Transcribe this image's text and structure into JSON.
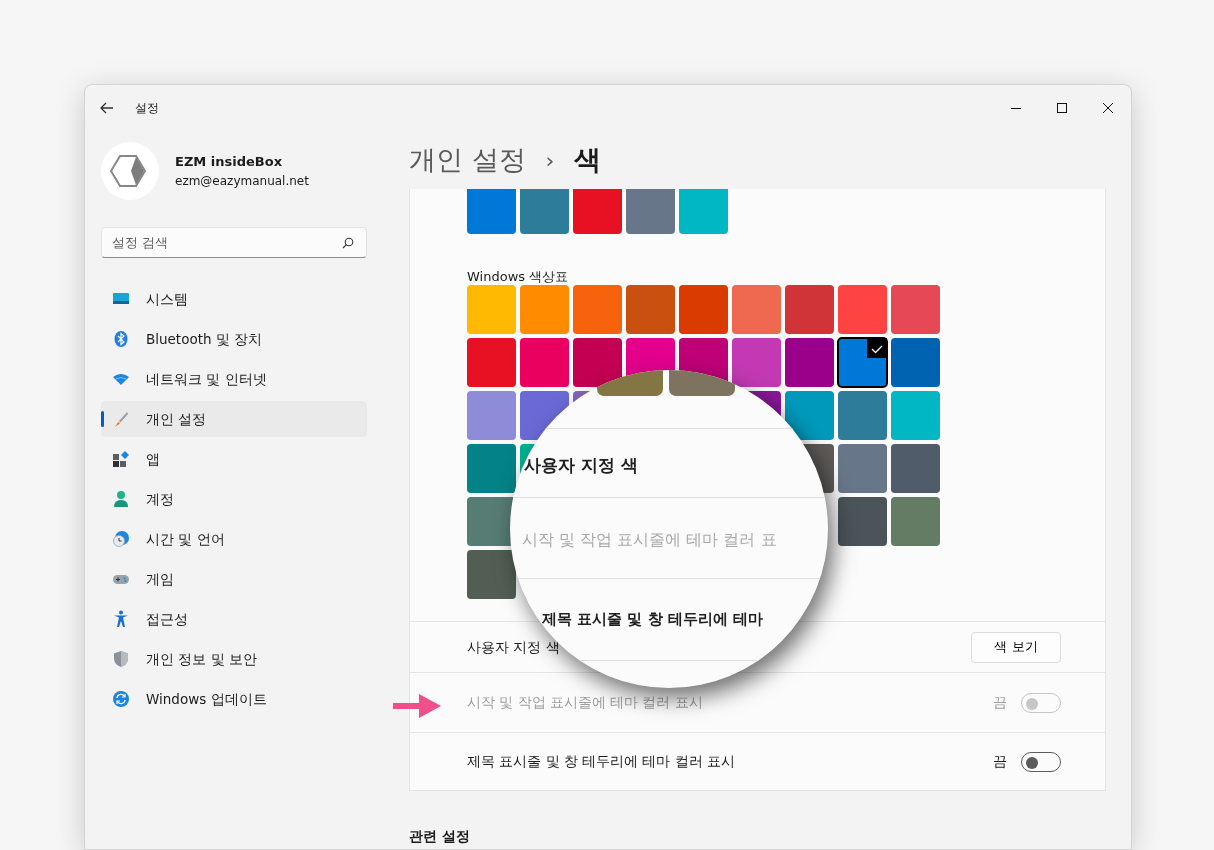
{
  "window": {
    "title": "설정"
  },
  "account": {
    "name": "EZM insideBox",
    "email": "ezm@eazymanual.net"
  },
  "search": {
    "placeholder": "설정 검색"
  },
  "sidebar": {
    "items": [
      {
        "label": "시스템",
        "kind": "system",
        "selected": false
      },
      {
        "label": "Bluetooth 및 장치",
        "kind": "bluetooth",
        "selected": false
      },
      {
        "label": "네트워크 및 인터넷",
        "kind": "network",
        "selected": false
      },
      {
        "label": "개인 설정",
        "kind": "personalization",
        "selected": true
      },
      {
        "label": "앱",
        "kind": "apps",
        "selected": false
      },
      {
        "label": "계정",
        "kind": "accounts",
        "selected": false
      },
      {
        "label": "시간 및 언어",
        "kind": "time",
        "selected": false
      },
      {
        "label": "게임",
        "kind": "gaming",
        "selected": false
      },
      {
        "label": "접근성",
        "kind": "accessibility",
        "selected": false
      },
      {
        "label": "개인 정보 및 보안",
        "kind": "privacy",
        "selected": false
      },
      {
        "label": "Windows 업데이트",
        "kind": "update",
        "selected": false
      }
    ]
  },
  "breadcrumb": {
    "parent": "개인 설정",
    "separator": "›",
    "current": "색"
  },
  "recent_colors": [
    {
      "color": "#0078d7"
    },
    {
      "color": "#2d7d9a"
    },
    {
      "color": "#e81123"
    },
    {
      "color": "#68768a"
    },
    {
      "color": "#00b7c3"
    }
  ],
  "palette": {
    "title": "Windows 색상표",
    "rows": [
      {
        "left": [
          {
            "color": "#ffb900",
            "selected": false
          },
          {
            "color": "#ff8c00",
            "selected": false
          },
          {
            "color": "#f7630c",
            "selected": false
          },
          {
            "color": "#ca5010",
            "selected": false
          },
          {
            "color": "#da3b01",
            "selected": false
          },
          {
            "color": "#ef6950",
            "selected": false
          },
          {
            "color": "#d13438",
            "selected": false
          },
          {
            "color": "#ff4343",
            "selected": false
          },
          {
            "color": "#e74856",
            "selected": false
          }
        ]
      },
      {
        "left": [
          {
            "color": "#e81123",
            "selected": false
          },
          {
            "color": "#ea005e",
            "selected": false
          },
          {
            "color": "#c30052",
            "selected": false
          },
          {
            "color": "#e3008c",
            "selected": false
          },
          {
            "color": "#bf0077",
            "selected": false
          },
          {
            "color": "#c239b3",
            "selected": false
          },
          {
            "color": "#9a0089",
            "selected": false
          },
          {
            "color": "#0078d7",
            "selected": true
          },
          {
            "color": "#0063b1",
            "selected": false
          }
        ]
      },
      {
        "left": [
          {
            "color": "#8e8cd8",
            "selected": false
          },
          {
            "color": "#6b69d6",
            "selected": false
          },
          {
            "color": "#8764b8",
            "selected": false
          }
        ],
        "right": [
          {
            "color": "#881798",
            "selected": false
          },
          {
            "color": "#0099bc",
            "selected": false
          },
          {
            "color": "#2d7d9a",
            "selected": false
          },
          {
            "color": "#00b7c3",
            "selected": false
          }
        ]
      },
      {
        "left": [
          {
            "color": "#038387",
            "selected": false
          },
          {
            "color": "#00b294",
            "selected": false
          }
        ],
        "right": [
          {
            "color": "#5d5a58",
            "selected": false
          },
          {
            "color": "#68768a",
            "selected": false
          },
          {
            "color": "#515c6b",
            "selected": false
          }
        ]
      },
      {
        "left": [
          {
            "color": "#567c73",
            "selected": false
          }
        ],
        "right": [
          {
            "color": "#4a5459",
            "selected": false
          },
          {
            "color": "#647c64",
            "selected": false
          }
        ]
      },
      {
        "left": [
          {
            "color": "#525e54",
            "selected": false
          }
        ]
      }
    ]
  },
  "settings": [
    {
      "kind": "button",
      "label": "사용자 지정 색",
      "button": "색 보기"
    },
    {
      "kind": "toggle",
      "label": "시작 및 작업 표시줄에 테마 컬러 표시",
      "state_text": "끔",
      "on": false,
      "disabled": true
    },
    {
      "kind": "toggle",
      "label": "제목 표시줄 및 창 테두리에 테마 컬러 표시",
      "state_text": "끔",
      "on": false,
      "disabled": false
    }
  ],
  "related": {
    "title": "관련 설정"
  },
  "magnifier": {
    "lines": [
      {
        "text": "사용자 지정 색",
        "disabled": false
      },
      {
        "text": "시작 및 작업 표시줄에 테마 컬러 표",
        "disabled": true
      },
      {
        "text": "제목 표시줄 및 창 테두리에 테마",
        "disabled": false
      }
    ]
  }
}
